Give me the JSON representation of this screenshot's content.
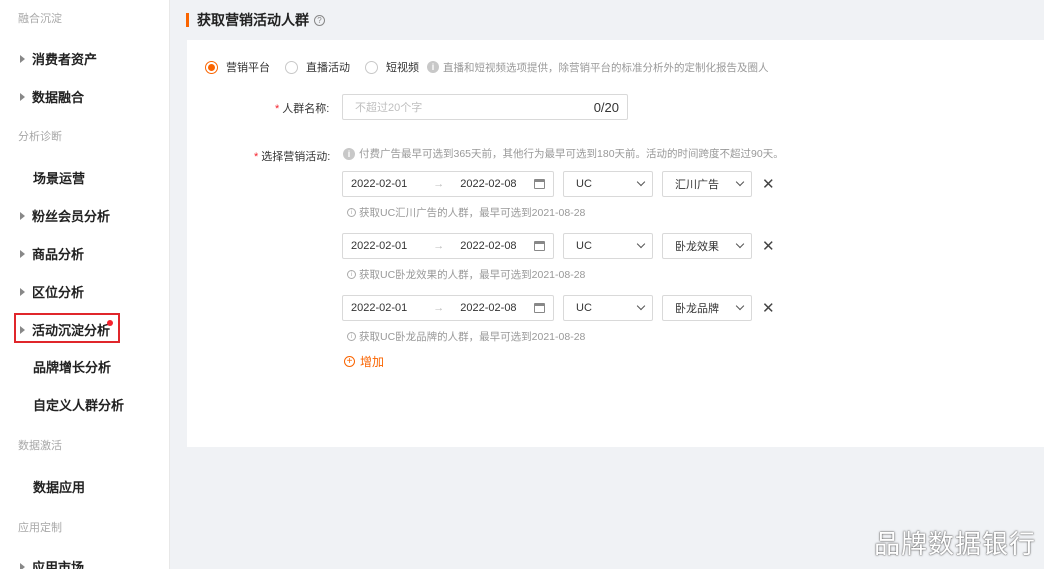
{
  "sidebar": {
    "sections": [
      {
        "label": "融合沉淀"
      },
      {
        "label": "分析诊断"
      },
      {
        "label": "数据激活"
      },
      {
        "label": "应用定制"
      }
    ],
    "items": [
      {
        "label": "消费者资产"
      },
      {
        "label": "数据融合"
      },
      {
        "label": "场景运营"
      },
      {
        "label": "粉丝会员分析"
      },
      {
        "label": "商品分析"
      },
      {
        "label": "区位分析"
      },
      {
        "label": "活动沉淀分析"
      },
      {
        "label": "品牌增长分析"
      },
      {
        "label": "自定义人群分析"
      },
      {
        "label": "数据应用"
      },
      {
        "label": "应用市场"
      }
    ]
  },
  "header": {
    "title": "获取营销活动人群",
    "help_icon": "?"
  },
  "platform": {
    "options": [
      {
        "label": "营销平台",
        "selected": true
      },
      {
        "label": "直播活动",
        "selected": false
      },
      {
        "label": "短视频",
        "selected": false
      }
    ],
    "hint": "直播和短视频选项提供，除营销平台的标准分析外的定制化报告及圈人"
  },
  "form": {
    "name_label": "人群名称:",
    "name_placeholder": "不超过20个字",
    "name_count": "0/20",
    "activity_label": "选择营销活动:",
    "activity_tip": "付费广告最早可选到365天前，其他行为最早可选到180天前。活动的时间跨度不超过90天。",
    "required_mark": "*"
  },
  "activities": [
    {
      "start": "2022-02-01",
      "end": "2022-02-08",
      "platform": "UC",
      "channel": "汇川广告",
      "hint": "获取UC汇川广告的人群，最早可选到2021-08-28"
    },
    {
      "start": "2022-02-01",
      "end": "2022-02-08",
      "platform": "UC",
      "channel": "卧龙效果",
      "hint": "获取UC卧龙效果的人群，最早可选到2021-08-28"
    },
    {
      "start": "2022-02-01",
      "end": "2022-02-08",
      "platform": "UC",
      "channel": "卧龙品牌",
      "hint": "获取UC卧龙品牌的人群，最早可选到2021-08-28"
    }
  ],
  "add_label": "增加",
  "watermark": "品牌数据银行",
  "colors": {
    "accent": "#fa6400",
    "highlight": "#e0262b"
  }
}
